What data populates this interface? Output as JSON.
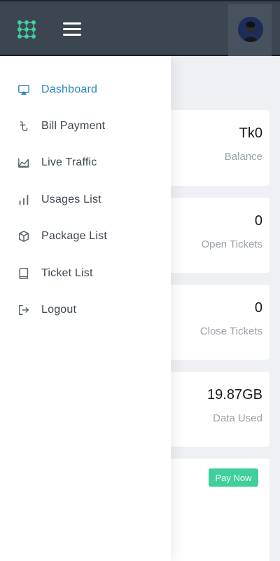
{
  "colors": {
    "topbar": "#3b4651",
    "accent_green": "#3fcf9a",
    "active_blue": "#2e86c1",
    "sidebar_text": "#3d4650",
    "muted_label": "#9aa1a8"
  },
  "header": {
    "logo_icon": "grid-dots-icon",
    "menu_icon": "hamburger-icon",
    "avatar_icon": "user-avatar"
  },
  "sidebar": {
    "items": [
      {
        "label": "Dashboard",
        "icon": "monitor-icon",
        "active": true
      },
      {
        "label": "Bill Payment",
        "icon": "taka-icon",
        "active": false
      },
      {
        "label": "Live Traffic",
        "icon": "area-chart-icon",
        "active": false
      },
      {
        "label": "Usages List",
        "icon": "bar-chart-icon",
        "active": false
      },
      {
        "label": "Package List",
        "icon": "box-icon",
        "active": false
      },
      {
        "label": "Ticket List",
        "icon": "book-icon",
        "active": false
      },
      {
        "label": "Logout",
        "icon": "logout-icon",
        "active": false
      }
    ]
  },
  "cards": [
    {
      "value": "Tk0",
      "label": "Balance"
    },
    {
      "value": "0",
      "label": "Open Tickets"
    },
    {
      "value": "0",
      "label": "Close Tickets"
    },
    {
      "value": "19.87GB",
      "label": "Data Used"
    }
  ],
  "payment": {
    "button_label": "Pay Now"
  }
}
